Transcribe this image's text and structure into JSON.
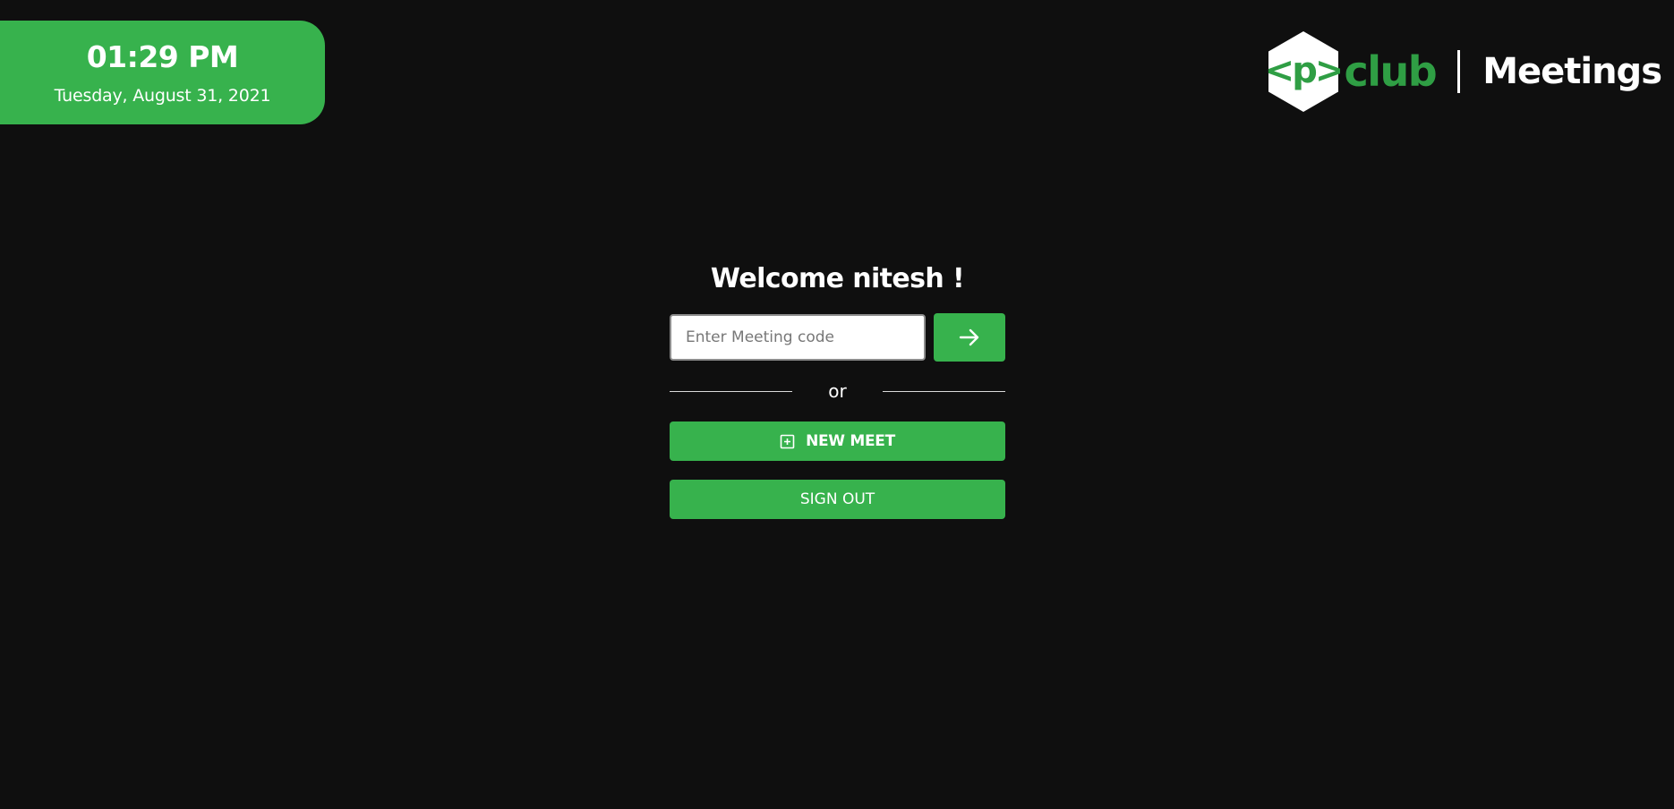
{
  "clock": {
    "time": "01:29 PM",
    "date": "Tuesday, August 31, 2021"
  },
  "brand": {
    "logo_text": "<p>",
    "club": "club",
    "title": "Meetings",
    "logo_icon": "hexagon-code-logo",
    "club_color": "#2f9e44"
  },
  "main": {
    "welcome": "Welcome nitesh !",
    "meeting_code": {
      "value": "",
      "placeholder": "Enter Meeting code"
    },
    "join_icon": "arrow-right-icon",
    "divider_text": "or",
    "new_meet_icon": "plus-square-icon",
    "new_meet_label": "NEW MEET",
    "sign_out_label": "SIGN OUT"
  },
  "colors": {
    "background": "#0f0f0f",
    "accent": "#37b24d"
  }
}
